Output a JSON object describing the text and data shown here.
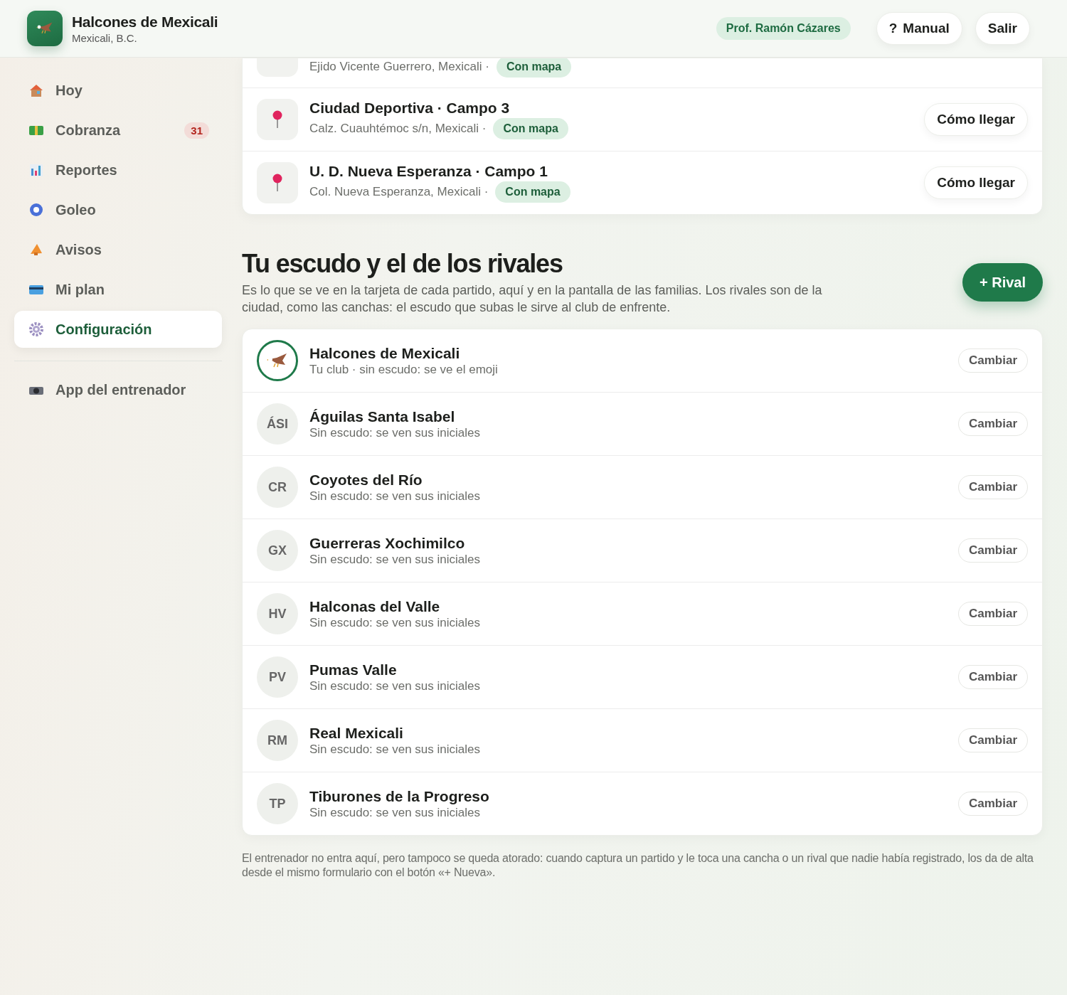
{
  "header": {
    "club_name": "Halcones de Mexicali",
    "club_city": "Mexicali, B.C.",
    "user": "Prof. Ramón Cázares",
    "buttons": [
      {
        "kind": "help",
        "label": "Manual",
        "icon": "?"
      },
      {
        "kind": "plain",
        "label": "Salir"
      }
    ]
  },
  "sidebar": {
    "items": [
      {
        "label": "Hoy",
        "selected": false
      },
      {
        "label": "Cobranza",
        "selected": false,
        "count": "31"
      },
      {
        "label": "Reportes",
        "selected": false
      },
      {
        "label": "Goleo",
        "selected": false
      },
      {
        "label": "Avisos",
        "selected": false
      },
      {
        "label": "Mi plan",
        "selected": false
      },
      {
        "label": "Configuración",
        "selected": true
      }
    ],
    "footer_item": {
      "label": "App del entrenador"
    }
  },
  "venues": [
    {
      "kind": "partial",
      "address": "Ejido Vicente Guerrero, Mexicali ·",
      "badge": "Con mapa"
    },
    {
      "kind": "full",
      "name": "Ciudad Deportiva · Campo 3",
      "address": "Calz. Cuauhtémoc s/n, Mexicali ·",
      "badge": "Con mapa",
      "action": "Cómo llegar"
    },
    {
      "kind": "full",
      "name": "U. D. Nueva Esperanza · Campo 1",
      "address": "Col. Nueva Esperanza, Mexicali ·",
      "badge": "Con mapa",
      "action": "Cómo llegar"
    }
  ],
  "crests": {
    "title": "Tu escudo y el de los rivales",
    "description": "Es lo que se ve en la tarjeta de cada partido, aquí y en la pantalla de las familias. Los rivales son de la ciudad, como las canchas: el escudo que subas le sirve al club de enfrente.",
    "add_button": "+ Rival",
    "teams": [
      {
        "kind": "club",
        "name": "Halcones de Mexicali",
        "note": "Tu club · sin escudo: se ve el emoji",
        "action": "Cambiar"
      },
      {
        "kind": "rival",
        "initials": "ÁSI",
        "name": "Águilas Santa Isabel",
        "note": "Sin escudo: se ven sus iniciales",
        "action": "Cambiar"
      },
      {
        "kind": "rival",
        "initials": "CR",
        "name": "Coyotes del Río",
        "note": "Sin escudo: se ven sus iniciales",
        "action": "Cambiar"
      },
      {
        "kind": "rival",
        "initials": "GX",
        "name": "Guerreras Xochimilco",
        "note": "Sin escudo: se ven sus iniciales",
        "action": "Cambiar"
      },
      {
        "kind": "rival",
        "initials": "HV",
        "name": "Halconas del Valle",
        "note": "Sin escudo: se ven sus iniciales",
        "action": "Cambiar"
      },
      {
        "kind": "rival",
        "initials": "PV",
        "name": "Pumas Valle",
        "note": "Sin escudo: se ven sus iniciales",
        "action": "Cambiar"
      },
      {
        "kind": "rival",
        "initials": "RM",
        "name": "Real Mexicali",
        "note": "Sin escudo: se ven sus iniciales",
        "action": "Cambiar"
      },
      {
        "kind": "rival",
        "initials": "TP",
        "name": "Tiburones de la Progreso",
        "note": "Sin escudo: se ven sus iniciales",
        "action": "Cambiar"
      }
    ],
    "footnote": "El entrenador no entra aquí, pero tampoco se queda atorado: cuando captura un partido y le toca una cancha o un rival que nadie había registrado, los da de alta desde el mismo formulario con el botón «+ Nueva»."
  }
}
